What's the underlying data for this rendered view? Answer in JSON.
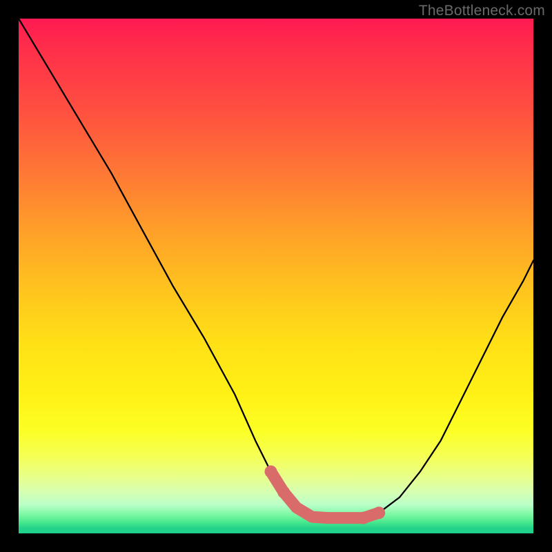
{
  "watermark": "TheBottleneck.com",
  "colors": {
    "black": "#000000",
    "curve": "#000000",
    "marker": "#d96b6a"
  },
  "chart_data": {
    "type": "line",
    "title": "",
    "xlabel": "",
    "ylabel": "",
    "xlim": [
      0,
      100
    ],
    "ylim": [
      0,
      100
    ],
    "grid": false,
    "legend": false,
    "series": [
      {
        "name": "bottleneck-curve-left",
        "x": [
          0,
          6,
          12,
          18,
          24,
          30,
          36,
          42,
          46,
          49,
          51.5,
          54,
          57,
          60,
          63
        ],
        "values": [
          100,
          90,
          80,
          70,
          59,
          48,
          38,
          27,
          18,
          12,
          8,
          5,
          3.2,
          3,
          3
        ]
      },
      {
        "name": "bottleneck-curve-right",
        "x": [
          63,
          67,
          70,
          74,
          78,
          82,
          86,
          90,
          94,
          98,
          100
        ],
        "values": [
          3,
          3,
          4,
          7,
          12,
          18,
          26,
          34,
          42,
          49,
          53
        ]
      },
      {
        "name": "highlight-band",
        "x": [
          49,
          51.5,
          54,
          57,
          60,
          63,
          67,
          70
        ],
        "values": [
          12,
          8,
          5,
          3.2,
          3,
          3,
          3,
          4
        ]
      }
    ],
    "annotations": []
  }
}
